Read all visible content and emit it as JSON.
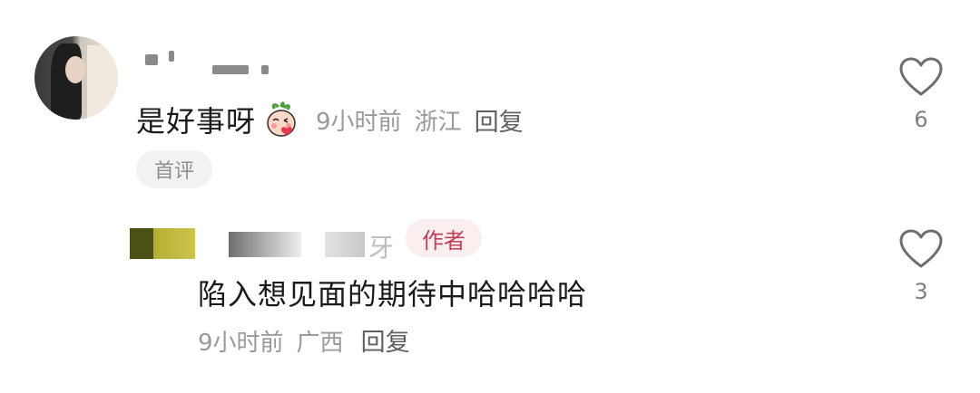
{
  "comments": [
    {
      "text": "是好事呀",
      "emoji": "blushing-radish-emoji",
      "time": "9小时前",
      "location": "浙江",
      "reply": "回复",
      "badge": "首评",
      "likes": "6"
    },
    {
      "name_fragment": "牙",
      "author_badge": "作者",
      "text": "陷入想见面的期待中哈哈哈哈",
      "time": "9小时前",
      "location": "广西",
      "reply": "回复",
      "likes": "3"
    }
  ],
  "colors": {
    "text": "#1a1a1a",
    "meta": "#999999",
    "author_badge_text": "#c04058",
    "author_badge_bg": "#fbeeee",
    "badge_bg": "#f2f2f2"
  }
}
